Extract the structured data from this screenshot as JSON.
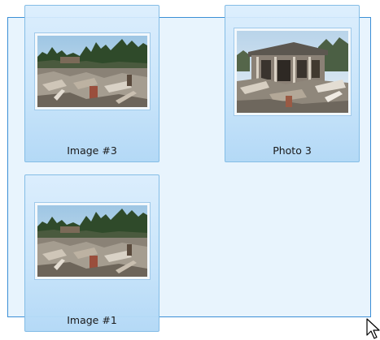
{
  "items": [
    {
      "caption": "Image #3",
      "thumbnail": "debris-landscape"
    },
    {
      "caption": "Photo 3",
      "thumbnail": "damaged-house"
    },
    {
      "caption": "Image #1",
      "thumbnail": "debris-landscape"
    }
  ],
  "colors": {
    "selection_border": "#3c8fd6",
    "selection_fill": "#cde6fa",
    "tile_border": "#84bde6",
    "tile_fill": "#c8e4fa"
  },
  "cursor": "arrow-cursor-icon"
}
